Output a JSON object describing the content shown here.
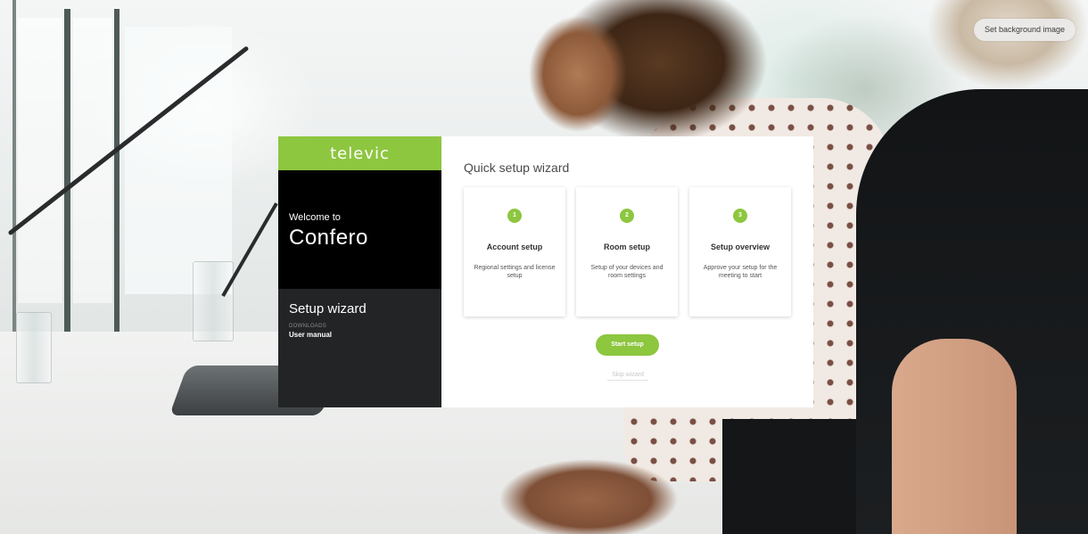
{
  "top_actions": {
    "set_background_label": "Set background image"
  },
  "sidebar": {
    "brand": "televic",
    "welcome_small": "Welcome to",
    "welcome_big": "Confero",
    "setup_title": "Setup wizard",
    "downloads_label": "DOWNLOADS",
    "user_manual_label": "User manual"
  },
  "wizard": {
    "title": "Quick setup wizard",
    "steps": [
      {
        "number": "1",
        "title": "Account setup",
        "description": "Regional settings and license setup"
      },
      {
        "number": "2",
        "title": "Room setup",
        "description": "Setup of your devices and room settings"
      },
      {
        "number": "3",
        "title": "Setup overview",
        "description": "Approve your setup for the meeting to start"
      }
    ],
    "start_label": "Start setup",
    "skip_label": "Skip wizard"
  },
  "colors": {
    "accent": "#8dc63f",
    "sidebar_top": "#000000",
    "sidebar_bottom": "#222426"
  },
  "icons": {
    "brand_logo": "televic-logo"
  }
}
